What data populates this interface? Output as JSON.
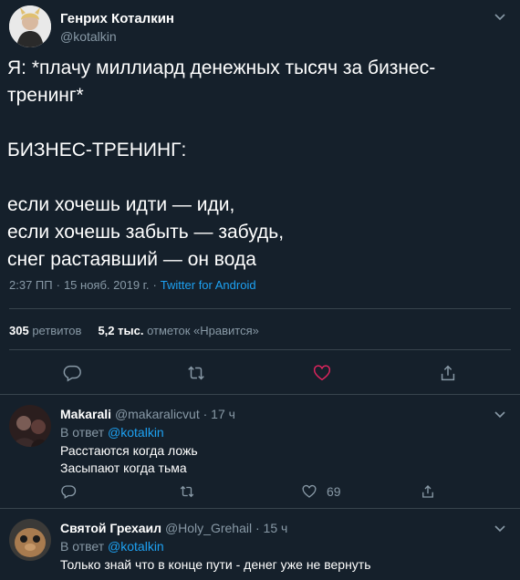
{
  "main_tweet": {
    "author_name": "Генрих Коталкин",
    "author_handle": "@kotalkin",
    "text": "Я: *плачу миллиард денежных тысяч за бизнес-\nтренинг*\n\nБИЗНЕС-ТРЕНИНГ:\n\nесли хочешь идти — иди,\nесли хочешь забыть — забудь,\nснег растаявший — он вода",
    "time": "2:37 ПП",
    "date": "15 нояб. 2019 г.",
    "separator": "·",
    "source": "Twitter for Android",
    "retweets_count": "305",
    "retweets_label": "ретвитов",
    "likes_count": "5,2 тыс.",
    "likes_label": "отметок «Нравится»"
  },
  "replies": [
    {
      "author_name": "Makarali",
      "author_handle": "@makaralicvut",
      "time": "· 17 ч",
      "reply_prefix": "В ответ",
      "reply_to": "@kotalkin",
      "text": "Расстаются когда ложь\nЗасыпают когда тьма",
      "like_count": "69"
    },
    {
      "author_name": "Святой Грехаил",
      "author_handle": "@Holy_Grehail",
      "time": "· 15 ч",
      "reply_prefix": "В ответ",
      "reply_to": "@kotalkin",
      "text": "Только знай что в конце пути - денег уже не вернуть"
    }
  ],
  "icons": {
    "reply": "reply-icon",
    "retweet": "retweet-icon",
    "like": "heart-icon",
    "share": "share-icon",
    "more": "chevron-down-icon"
  },
  "colors": {
    "background": "#15202b",
    "muted": "#8899a6",
    "link": "#1da1f2",
    "divider": "#38444d"
  }
}
